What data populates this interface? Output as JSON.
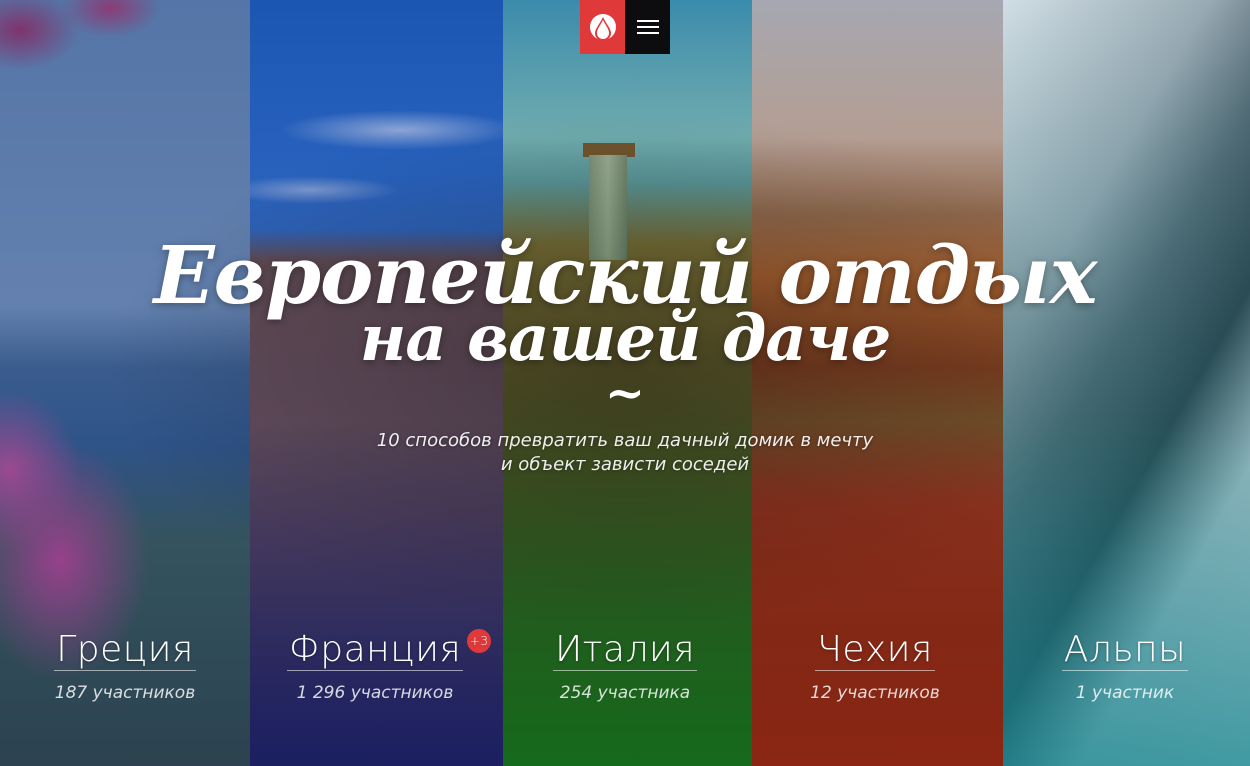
{
  "hero": {
    "title_line1": "Европейский отдых",
    "title_line2": "на вашей даче",
    "ornament": "~",
    "subtitle_line1": "10 способов превратить ваш дачный домик в мечту",
    "subtitle_line2": "и объект зависти соседей"
  },
  "topbar": {
    "logo_icon": "drop-icon",
    "menu_icon": "hamburger-icon",
    "logo_color": "#e0393a",
    "menu_color": "#0d0d0f"
  },
  "countries": [
    {
      "name": "Греция",
      "count": "187 участников",
      "tint": "#304a8c"
    },
    {
      "name": "Франция",
      "count": "1 296 участников",
      "badge": "+3",
      "tint": "#122478"
    },
    {
      "name": "Италия",
      "count": "254 участника",
      "tint": "#147a1e"
    },
    {
      "name": "Чехия",
      "count": "12 участников",
      "tint": "#a02814"
    },
    {
      "name": "Альпы",
      "count": "1 участник",
      "tint": "#14828c"
    }
  ]
}
